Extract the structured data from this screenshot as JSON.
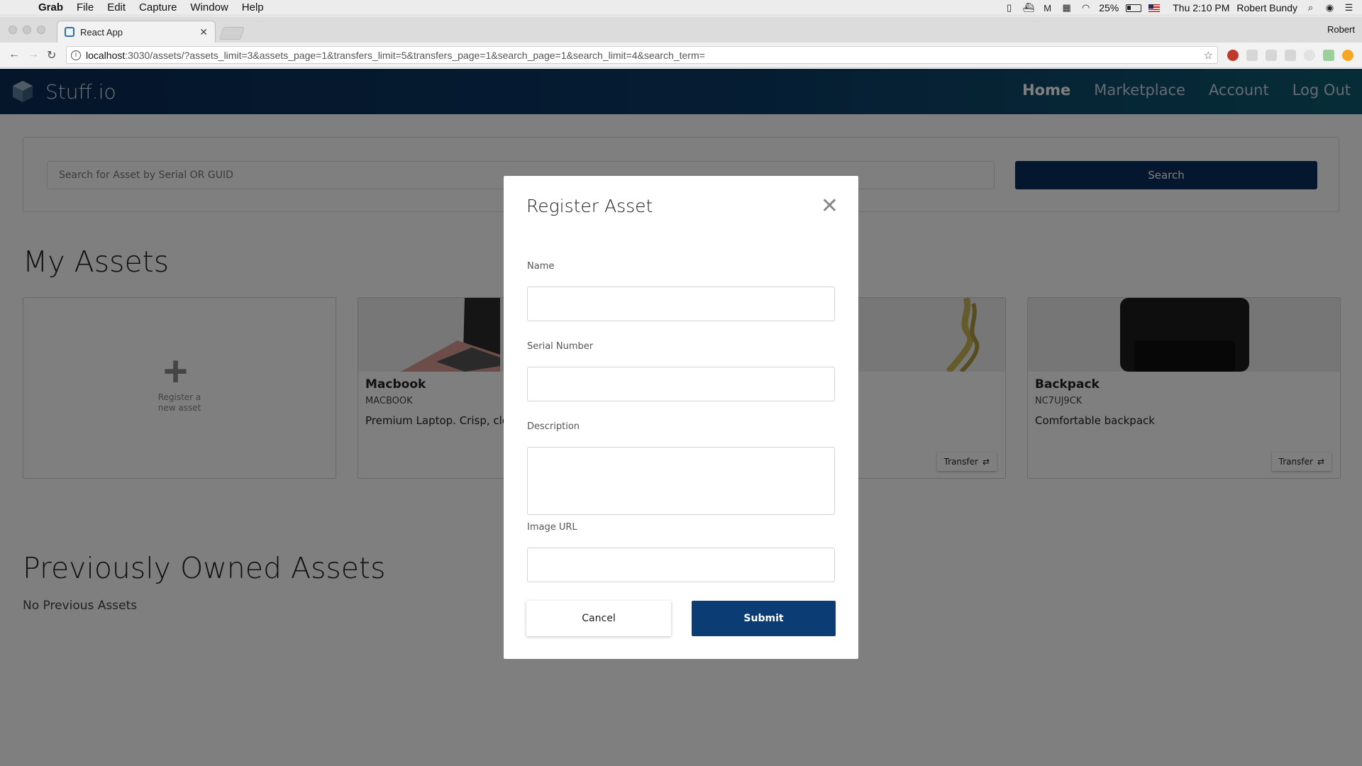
{
  "menubar": {
    "items": [
      "Grab",
      "File",
      "Edit",
      "Capture",
      "Window",
      "Help"
    ],
    "battery": "25%",
    "clock": "Thu 2:10 PM",
    "user": "Robert Bundy"
  },
  "browser": {
    "tab_title": "React App",
    "profile": "Robert",
    "url_host": "localhost",
    "url_rest": ":3030/assets/?assets_limit=3&assets_page=1&transfers_limit=5&transfers_page=1&search_page=1&search_limit=4&search_term="
  },
  "app": {
    "brand": "Stuff.io",
    "nav": [
      "Home",
      "Marketplace",
      "Account",
      "Log Out"
    ],
    "search_placeholder": "Search for Asset by Serial OR GUID",
    "search_button": "Search",
    "my_assets_title": "My Assets",
    "register_label_line1": "Register a",
    "register_label_line2": "new asset",
    "assets": [
      {
        "name": "Macbook",
        "serial": "MACBOOK",
        "description": "Premium Laptop. Crisp, cle"
      },
      {
        "name": "",
        "serial": "",
        "description": ""
      },
      {
        "name": "Backpack",
        "serial": "NC7UJ9CK",
        "description": "Comfortable backpack"
      }
    ],
    "transfer_label": "Transfer",
    "prev_title": "Previously Owned Assets",
    "no_prev": "No Previous Assets"
  },
  "modal": {
    "title": "Register Asset",
    "fields": {
      "name_label": "Name",
      "serial_label": "Serial Number",
      "description_label": "Description",
      "image_label": "Image URL"
    },
    "cancel": "Cancel",
    "submit": "Submit"
  },
  "colors": {
    "header_start": "#0b2a55",
    "header_end": "#0d5a6e",
    "primary": "#0b3d74"
  }
}
